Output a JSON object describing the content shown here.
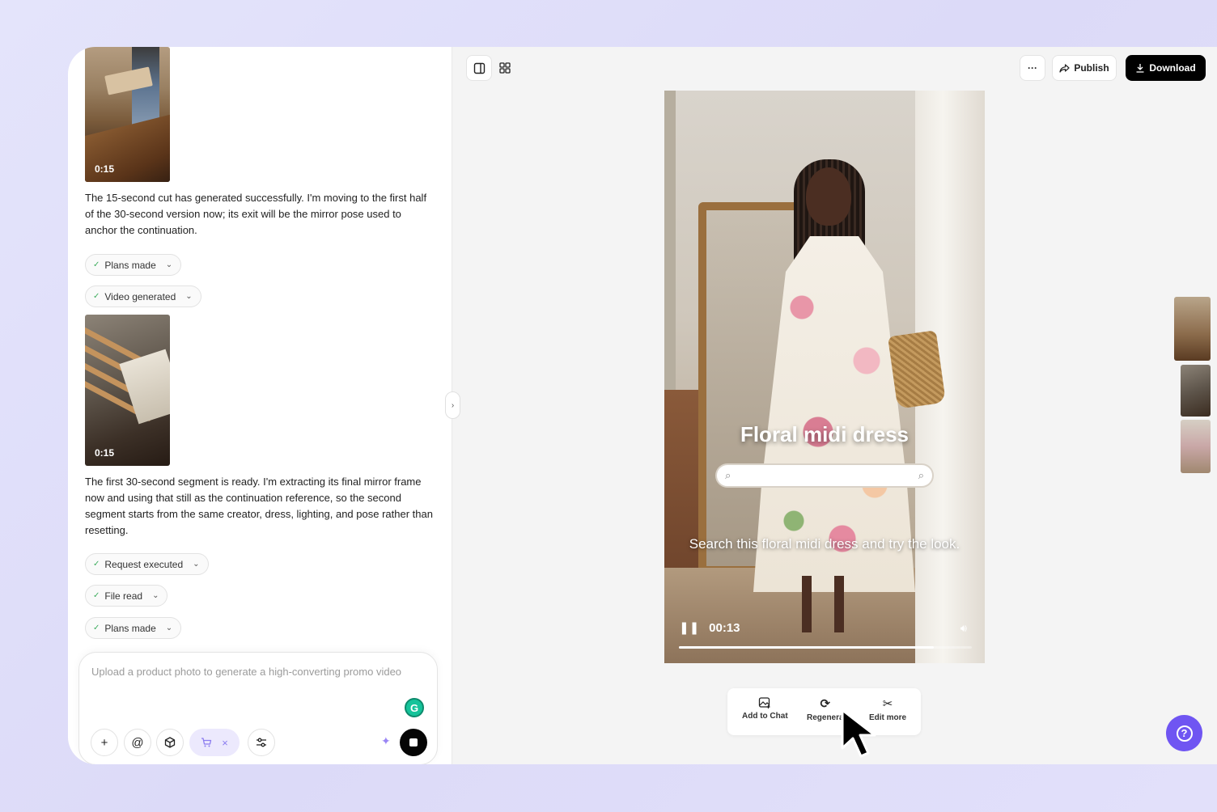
{
  "chat": {
    "thumb1_duration": "0:15",
    "message1": "The 15-second cut has generated successfully. I'm moving to the first half of the 30-second version now; its exit will be the mirror pose used to anchor the continuation.",
    "pills_a": [
      "Plans made",
      "Video generated"
    ],
    "thumb2_duration": "0:15",
    "message2": "The first 30-second segment is ready. I'm extracting its final mirror frame now and using that still as the continuation reference, so the second segment starts from the same creator, dress, lighting, and pose rather than resetting.",
    "pills_b": [
      "Request executed",
      "File read",
      "Plans made"
    ]
  },
  "composer": {
    "placeholder": "Upload a product photo to generate a high-converting promo video"
  },
  "toolbar": {
    "more_label": "···",
    "publish_label": "Publish",
    "download_label": "Download"
  },
  "video": {
    "title": "Floral midi dress",
    "caption": "Search this floral midi dress and try the look.",
    "time": "00:13",
    "progress": 0.87
  },
  "actions": {
    "add_to_chat": "Add to Chat",
    "regenerate": "Regenera",
    "edit_more": "Edit more"
  },
  "icons": {
    "panel": "panel-right-icon",
    "grid": "grid-icon",
    "help": "help-icon"
  },
  "colors": {
    "accent": "#6f55f2",
    "download_bg": "#000000",
    "cart_pill_bg": "#ece9fd",
    "check": "#3fae5f"
  }
}
